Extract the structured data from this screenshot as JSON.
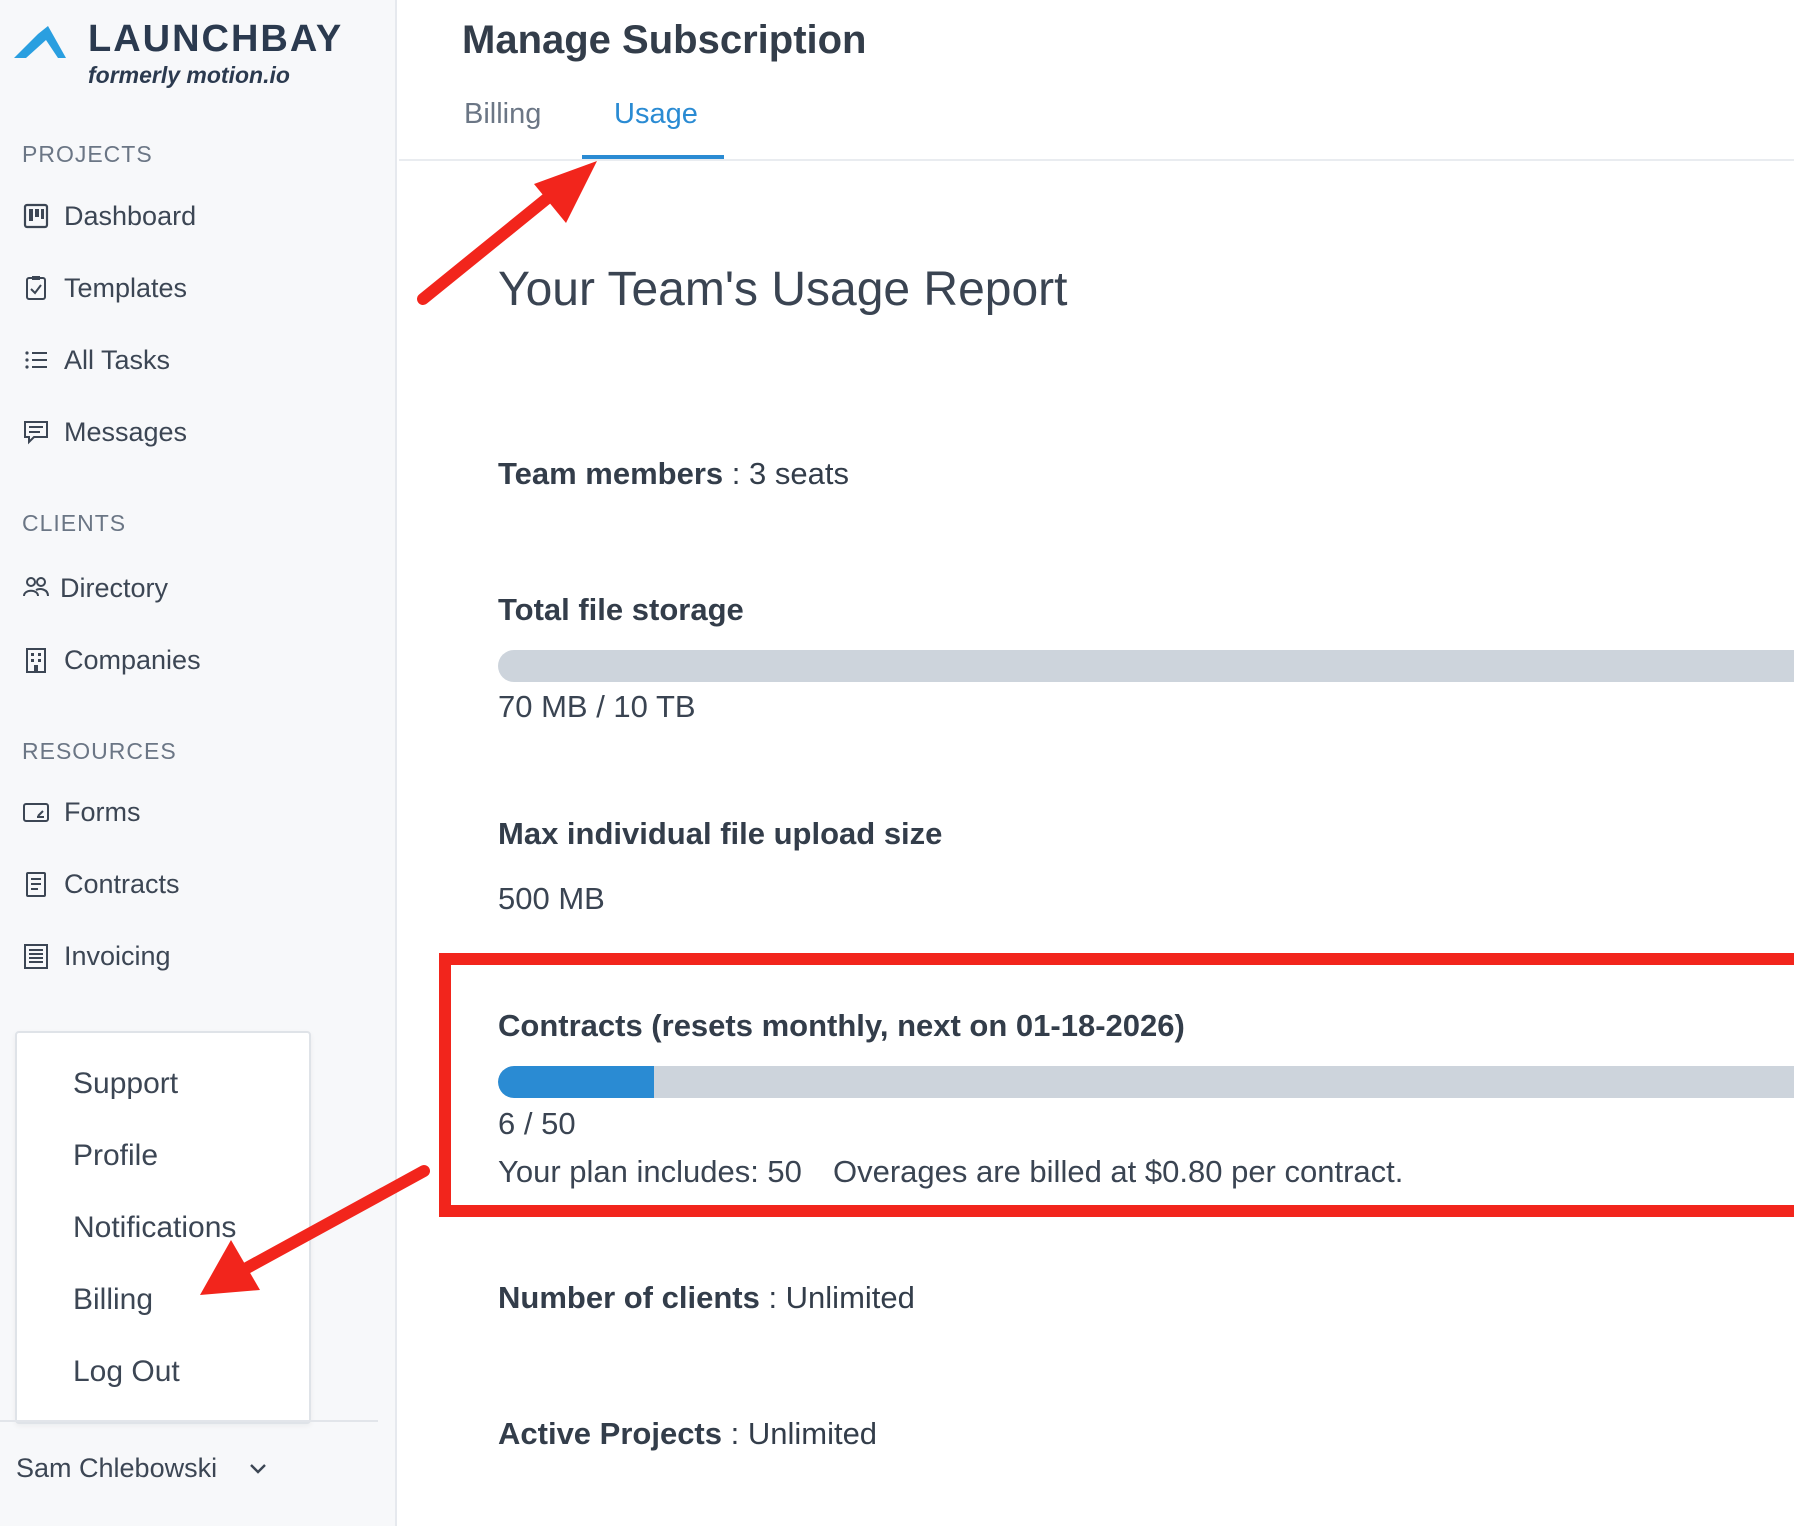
{
  "brand": {
    "name": "LAUNCHBAY",
    "tagline": "formerly motion.io",
    "accent": "#2a9fe0"
  },
  "sidebar": {
    "sections": [
      {
        "title": "PROJECTS",
        "items": [
          {
            "label": "Dashboard",
            "icon": "dashboard-icon"
          },
          {
            "label": "Templates",
            "icon": "clipboard-check-icon"
          },
          {
            "label": "All Tasks",
            "icon": "list-icon"
          },
          {
            "label": "Messages",
            "icon": "message-icon"
          }
        ]
      },
      {
        "title": "CLIENTS",
        "items": [
          {
            "label": "Directory",
            "icon": "people-icon"
          },
          {
            "label": "Companies",
            "icon": "building-icon"
          }
        ]
      },
      {
        "title": "RESOURCES",
        "items": [
          {
            "label": "Forms",
            "icon": "form-icon"
          },
          {
            "label": "Contracts",
            "icon": "document-icon"
          },
          {
            "label": "Invoicing",
            "icon": "invoice-icon"
          }
        ]
      }
    ],
    "menu": [
      "Support",
      "Profile",
      "Notifications",
      "Billing",
      "Log Out"
    ],
    "user": {
      "name": "Sam Chlebowski",
      "icon": "chevron-down-icon"
    }
  },
  "header": {
    "title": "Manage Subscription",
    "tabs": [
      {
        "label": "Billing",
        "active": false
      },
      {
        "label": "Usage",
        "active": true
      }
    ]
  },
  "report": {
    "title": "Your Team's Usage Report",
    "team_members": {
      "label": "Team members",
      "separator": " : ",
      "value": "3 seats"
    },
    "storage": {
      "label": "Total file storage",
      "value": "70 MB / 10 TB",
      "fill_fraction": 0.0
    },
    "max_upload": {
      "label": "Max individual file upload size",
      "value": "500 MB"
    },
    "contracts": {
      "label": "Contracts (resets monthly, next on 01-18-2026)",
      "used": 6,
      "limit": 50,
      "value": "6 / 50",
      "plan_includes": "Your plan includes: 50",
      "overage": "Overages are billed at $0.80 per contract."
    },
    "clients": {
      "label": "Number of clients",
      "separator": " : ",
      "value": "Unlimited"
    },
    "projects": {
      "label": "Active Projects",
      "separator": " : ",
      "value": "Unlimited"
    }
  },
  "colors": {
    "accent": "#2a8bd3",
    "progress_track": "#cdd4dc",
    "annotation_red": "#f2251c"
  }
}
